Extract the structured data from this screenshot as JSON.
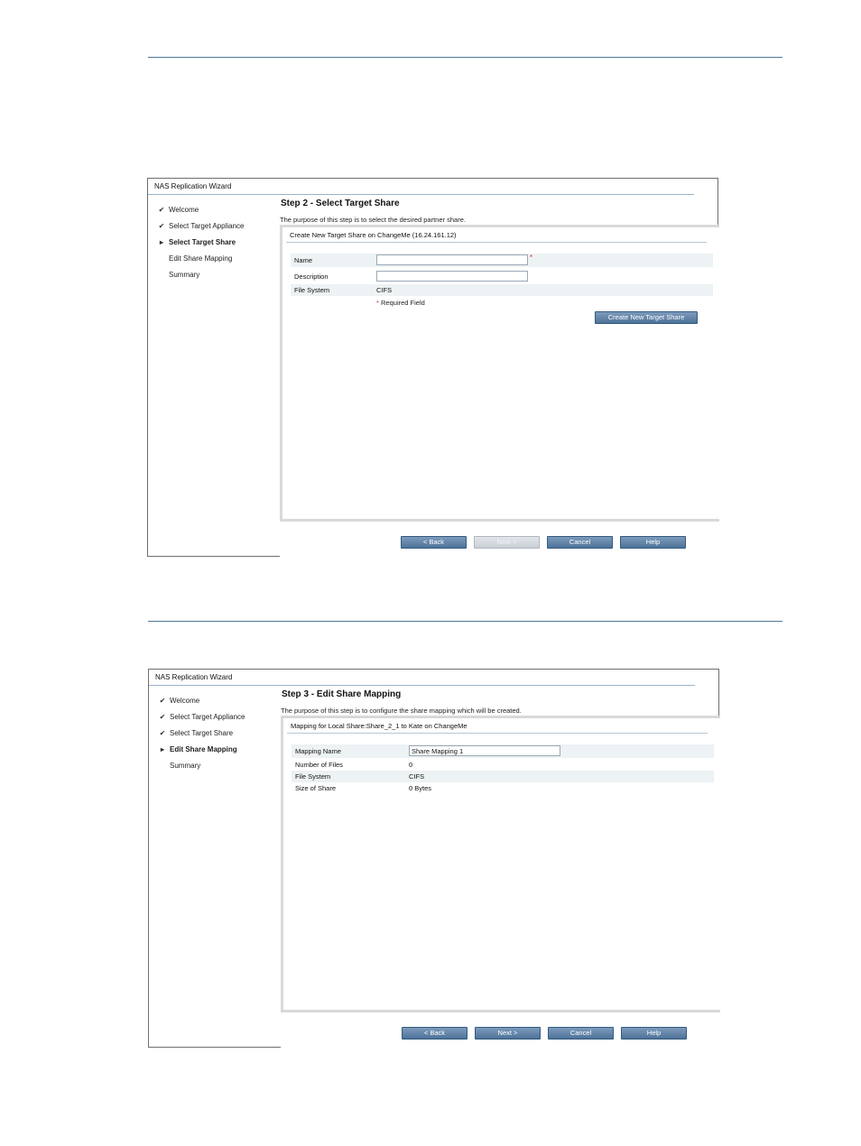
{
  "wizard1": {
    "title": "NAS Replication Wizard",
    "nav": [
      {
        "label": "Welcome",
        "mark": "✔"
      },
      {
        "label": "Select Target Appliance",
        "mark": "✔"
      },
      {
        "label": "Select Target Share",
        "mark": "▸"
      },
      {
        "label": "Edit Share Mapping",
        "mark": ""
      },
      {
        "label": "Summary",
        "mark": ""
      }
    ],
    "step_title": "Step 2 - Select Target Share",
    "step_desc": "The purpose of this step is to select the desired partner share.",
    "panel_title": "Create New Target Share on ChangeMe (16.24.161.12)",
    "fields": {
      "name_label": "Name",
      "name_value": "",
      "description_label": "Description",
      "description_value": "",
      "filesystem_label": "File System",
      "filesystem_value": "CIFS",
      "required_star": "*",
      "required_note": "Required Field"
    },
    "create_button": "Create New Target Share",
    "buttons": {
      "back": "< Back",
      "next": "Next >",
      "cancel": "Cancel",
      "help": "Help"
    }
  },
  "wizard2": {
    "title": "NAS Replication Wizard",
    "nav": [
      {
        "label": "Welcome",
        "mark": "✔"
      },
      {
        "label": "Select Target Appliance",
        "mark": "✔"
      },
      {
        "label": "Select Target Share",
        "mark": "✔"
      },
      {
        "label": "Edit Share Mapping",
        "mark": "▸"
      },
      {
        "label": "Summary",
        "mark": ""
      }
    ],
    "step_title": "Step 3 - Edit Share Mapping",
    "step_desc": "The purpose of this step is to configure the share mapping which will be created.",
    "panel_title": "Mapping for Local Share:Share_2_1 to Kate on ChangeMe",
    "fields": {
      "mapping_name_label": "Mapping Name",
      "mapping_name_value": "Share Mapping 1",
      "files_label": "Number of Files",
      "files_value": "0",
      "filesystem_label": "File System",
      "filesystem_value": "CIFS",
      "size_label": "Size of Share",
      "size_value": "0 Bytes"
    },
    "buttons": {
      "back": "< Back",
      "next": "Next >",
      "cancel": "Cancel",
      "help": "Help"
    }
  }
}
